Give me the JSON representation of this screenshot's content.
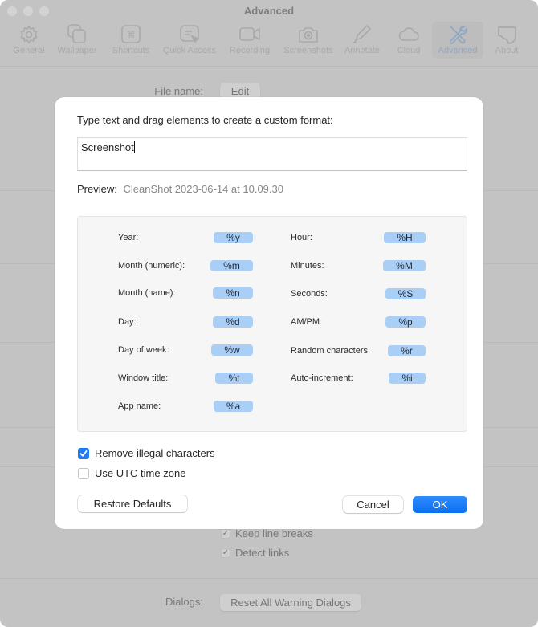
{
  "window": {
    "title": "Advanced",
    "toolbar": [
      {
        "label": "General",
        "icon": "gear-icon",
        "active": false
      },
      {
        "label": "Wallpaper",
        "icon": "wallpaper-icon",
        "active": false
      },
      {
        "label": "Shortcuts",
        "icon": "command-key-icon",
        "active": false
      },
      {
        "label": "Quick Access",
        "icon": "quick-access-icon",
        "active": false
      },
      {
        "label": "Recording",
        "icon": "video-camera-icon",
        "active": false
      },
      {
        "label": "Screenshots",
        "icon": "camera-icon",
        "active": false
      },
      {
        "label": "Annotate",
        "icon": "highlighter-icon",
        "active": false
      },
      {
        "label": "Cloud",
        "icon": "cloud-icon",
        "active": false
      },
      {
        "label": "Advanced",
        "icon": "tools-icon",
        "active": true
      },
      {
        "label": "About",
        "icon": "about-icon",
        "active": false
      }
    ],
    "background": {
      "file_name_label": "File name:",
      "file_name_button": "Edit",
      "keep_line_breaks": {
        "label": "Keep line breaks",
        "checked": true
      },
      "detect_links": {
        "label": "Detect links",
        "checked": true
      },
      "dialogs_label": "Dialogs:",
      "reset_dialogs_button": "Reset All Warning Dialogs"
    }
  },
  "dialog": {
    "instructions": "Type text and drag elements to create a custom format:",
    "format_value": "Screenshot",
    "preview_label": "Preview:",
    "preview_value": "CleanShot 2023-06-14 at 10.09.30",
    "tokens_left": [
      {
        "label": "Year:",
        "token": "%y"
      },
      {
        "label": "Month (numeric):",
        "token": "%m"
      },
      {
        "label": "Month (name):",
        "token": "%n"
      },
      {
        "label": "Day:",
        "token": "%d"
      },
      {
        "label": "Day of week:",
        "token": "%w"
      },
      {
        "label": "Window title:",
        "token": "%t"
      },
      {
        "label": "App name:",
        "token": "%a"
      }
    ],
    "tokens_right": [
      {
        "label": "Hour:",
        "token": "%H"
      },
      {
        "label": "Minutes:",
        "token": "%M"
      },
      {
        "label": "Seconds:",
        "token": "%S"
      },
      {
        "label": "AM/PM:",
        "token": "%p"
      },
      {
        "label": "Random characters:",
        "token": "%r"
      },
      {
        "label": "Auto-increment:",
        "token": "%i"
      }
    ],
    "remove_illegal": {
      "label": "Remove illegal characters",
      "checked": true
    },
    "use_utc": {
      "label": "Use UTC time zone",
      "checked": false
    },
    "restore_defaults_button": "Restore Defaults",
    "cancel_button": "Cancel",
    "ok_button": "OK",
    "accent_color": "#1f7bf2",
    "token_color": "#a9cff7"
  }
}
